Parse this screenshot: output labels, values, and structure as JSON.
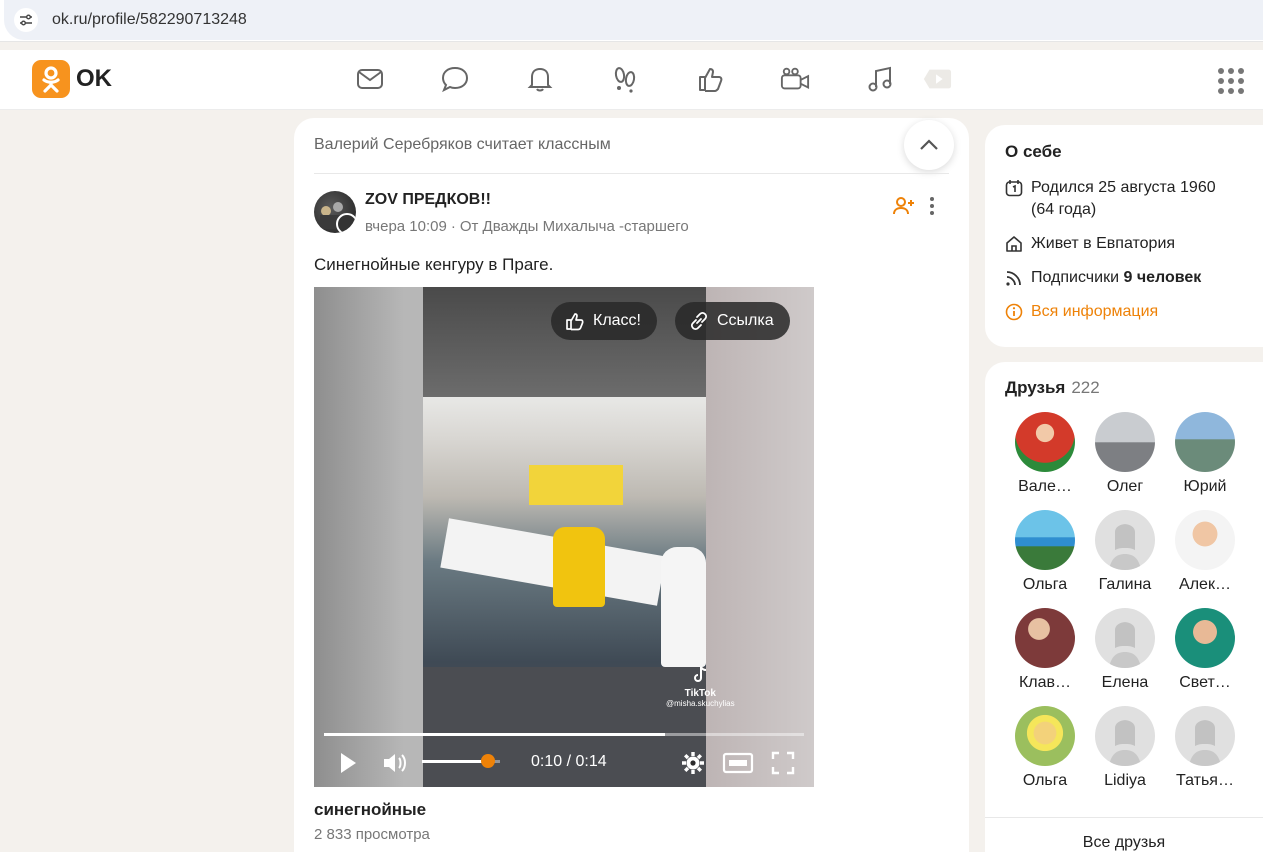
{
  "browser": {
    "url": "ok.ru/profile/582290713248"
  },
  "topnav": {
    "logo_text": "OK",
    "icons": [
      "mail-icon",
      "chat-icon",
      "bell-icon",
      "guests-icon",
      "like-icon",
      "video-icon",
      "music-icon",
      "play-icon"
    ]
  },
  "feed": {
    "header": "Валерий Серебряков считает классным",
    "post": {
      "group_name": "ZOV ПРЕДКОВ!!",
      "time": "вчера 10:09",
      "from": "От Дважды Михалыча -старшего",
      "text": "Синегнойные кенгуру в Праге.",
      "video": {
        "klass_label": "Класс!",
        "link_label": "Ссылка",
        "tiktok_label": "TikTok",
        "tiktok_user": "@misha.skuchylias",
        "time": "0:10 / 0:14",
        "progress": 0.71,
        "volume": 0.85
      },
      "video_title": "синегнойные",
      "views": "2 833 просмотра"
    }
  },
  "about": {
    "title": "О себе",
    "born": "Родился 25 августа 1960",
    "age": "(64 года)",
    "lives": "Живет в Евпатория",
    "subscribers_label": "Подписчики",
    "subscribers_count": "9 человек",
    "all_info": "Вся информация"
  },
  "friends": {
    "title": "Друзья",
    "count": "222",
    "list": [
      {
        "name": "Вале…"
      },
      {
        "name": "Олег"
      },
      {
        "name": "Юрий"
      },
      {
        "name": "Ольга"
      },
      {
        "name": "Галина"
      },
      {
        "name": "Алек…"
      },
      {
        "name": "Клав…"
      },
      {
        "name": "Елена"
      },
      {
        "name": "Свет…"
      },
      {
        "name": "Ольга"
      },
      {
        "name": "Lidiya"
      },
      {
        "name": "Татья…"
      }
    ],
    "all_label": "Все друзья"
  },
  "colors": {
    "accent": "#ee8208",
    "page_bg": "#f4f1ed"
  }
}
